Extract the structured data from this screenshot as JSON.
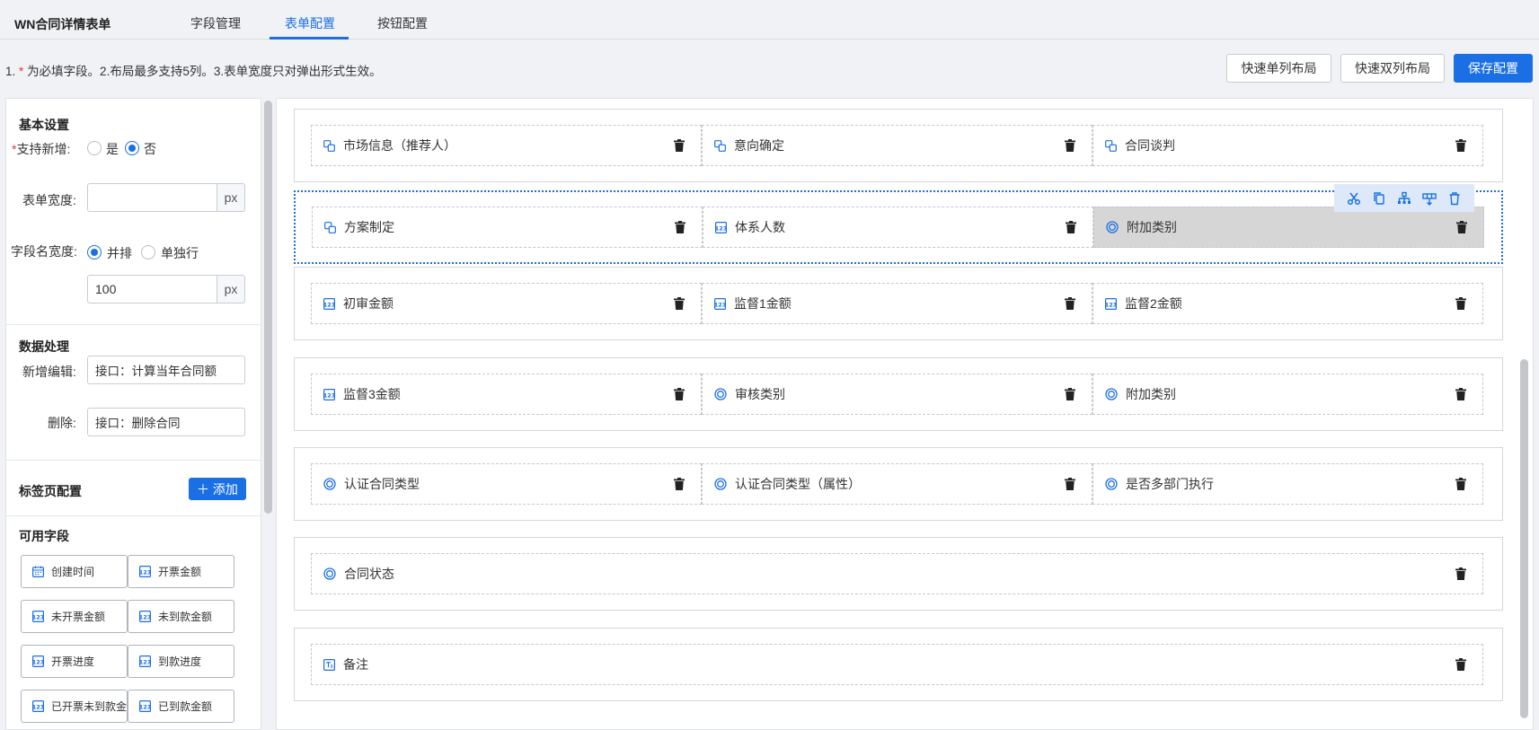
{
  "header": {
    "app_title": "WN合同详情表单",
    "tabs": [
      {
        "label": "字段管理",
        "active": false
      },
      {
        "label": "表单配置",
        "active": true
      },
      {
        "label": "按钮配置",
        "active": false
      }
    ]
  },
  "tip": {
    "prefix": "1.",
    "asterisk": "*",
    "text": "为必填字段。2.布局最多支持5列。3.表单宽度只对弹出形式生效。"
  },
  "actions": {
    "single_col": "快速单列布局",
    "double_col": "快速双列布局",
    "save": "保存配置"
  },
  "left": {
    "basic": {
      "title": "基本设置",
      "asterisk": "*",
      "allow_add_label": "支持新增:",
      "yes": "是",
      "no": "否",
      "allow_add_value": "否",
      "form_width_label": "表单宽度:",
      "form_width_value": "",
      "px": "px",
      "name_width_label": "字段名宽度:",
      "side_by_side": "并排",
      "single_line": "单独行",
      "name_width_mode": "并排",
      "name_width_value": "100"
    },
    "data": {
      "title": "数据处理",
      "add_edit_label": "新增编辑:",
      "add_edit_value": "接口：计算当年合同额",
      "delete_label": "删除:",
      "delete_value": "接口：删除合同"
    },
    "tabs_config": {
      "title": "标签页配置",
      "add_label": "＋ 添加"
    },
    "available": {
      "title": "可用字段",
      "fields": [
        {
          "label": "创建时间",
          "icon": "calendar-icon"
        },
        {
          "label": "开票金额",
          "icon": "number-icon"
        },
        {
          "label": "未开票金额",
          "icon": "number-icon"
        },
        {
          "label": "未到款金额",
          "icon": "number-icon"
        },
        {
          "label": "开票进度",
          "icon": "number-icon"
        },
        {
          "label": "到款进度",
          "icon": "number-icon"
        },
        {
          "label": "已开票未到款金额",
          "icon": "number-icon"
        },
        {
          "label": "已到款金额",
          "icon": "number-icon"
        }
      ]
    }
  },
  "canvas": {
    "rows": [
      {
        "cells": [
          {
            "label": "市场信息（推荐人）",
            "icon": "link-icon"
          },
          {
            "label": "意向确定",
            "icon": "link-icon"
          },
          {
            "label": "合同谈判",
            "icon": "link-icon"
          }
        ]
      },
      {
        "selected": true,
        "cells": [
          {
            "label": "方案制定",
            "icon": "link-icon"
          },
          {
            "label": "体系人数",
            "icon": "number-icon"
          },
          {
            "label": "附加类别",
            "icon": "radio-icon",
            "highlighted": true
          }
        ]
      },
      {
        "cells": [
          {
            "label": "初审金额",
            "icon": "number-icon"
          },
          {
            "label": "监督1金额",
            "icon": "number-icon"
          },
          {
            "label": "监督2金额",
            "icon": "number-icon"
          }
        ]
      },
      {
        "cells": [
          {
            "label": "监督3金额",
            "icon": "number-icon"
          },
          {
            "label": "审核类别",
            "icon": "radio-icon"
          },
          {
            "label": "附加类别",
            "icon": "radio-icon"
          }
        ]
      },
      {
        "cells": [
          {
            "label": "认证合同类型",
            "icon": "radio-icon"
          },
          {
            "label": "认证合同类型（属性）",
            "icon": "radio-icon"
          },
          {
            "label": "是否多部门执行",
            "icon": "radio-icon"
          }
        ]
      },
      {
        "cells": [
          {
            "label": "合同状态",
            "icon": "radio-icon"
          }
        ]
      },
      {
        "cells": [
          {
            "label": "备注",
            "icon": "textarea-icon"
          }
        ]
      }
    ],
    "row_toolbar": [
      "cut-icon",
      "copy-icon",
      "split-icon",
      "insert-column-icon",
      "delete-icon"
    ]
  },
  "colors": {
    "primary": "#1a6fe5",
    "required": "#e53935",
    "highlight": "#d6d6d6"
  }
}
